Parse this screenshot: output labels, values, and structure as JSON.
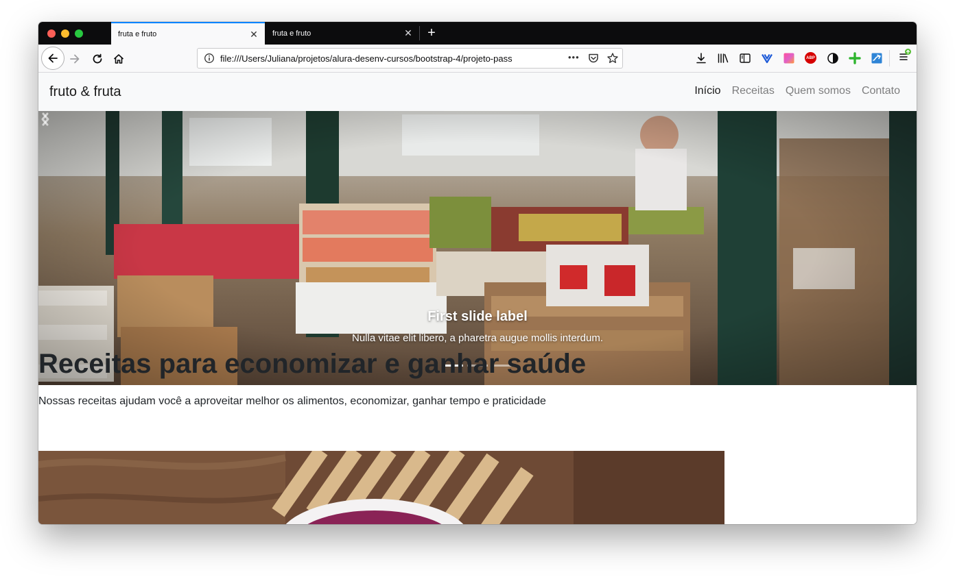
{
  "browser": {
    "tabs": [
      {
        "title": "fruta e fruto",
        "active": true
      },
      {
        "title": "fruta e fruto",
        "active": false
      }
    ],
    "new_tab_label": "+",
    "close_glyph": "✕",
    "url": "file:///Users/Juliana/projetos/alura-desenv-cursos/bootstrap-4/projeto-pass",
    "page_actions_label": "•••",
    "accent_color": "#0a84ff",
    "extensions": [
      "download-icon",
      "library-icon",
      "sidebar-icon",
      "vivaldi-icon",
      "gradient-extension-icon",
      "adblock-plus-icon",
      "privacy-badger-icon",
      "plus-extension-icon",
      "screenshot-extension-icon",
      "menu-icon"
    ],
    "abp_label": "ABP"
  },
  "site": {
    "brand": "fruto & fruta",
    "nav": [
      {
        "label": "Início",
        "active": true
      },
      {
        "label": "Receitas",
        "active": false
      },
      {
        "label": "Quem somos",
        "active": false
      },
      {
        "label": "Contato",
        "active": false
      }
    ]
  },
  "carousel": {
    "caption_title": "First slide label",
    "caption_text": "Nulla vitae elit libero, a pharetra augue mollis interdum.",
    "slide_count": 3,
    "active_slide": 1
  },
  "main": {
    "heading": "Receitas para economizar e ganhar saúde",
    "lead": "Nossas receitas ajudam você a aproveitar melhor os alimentos, economizar, ganhar tempo e praticidade"
  }
}
